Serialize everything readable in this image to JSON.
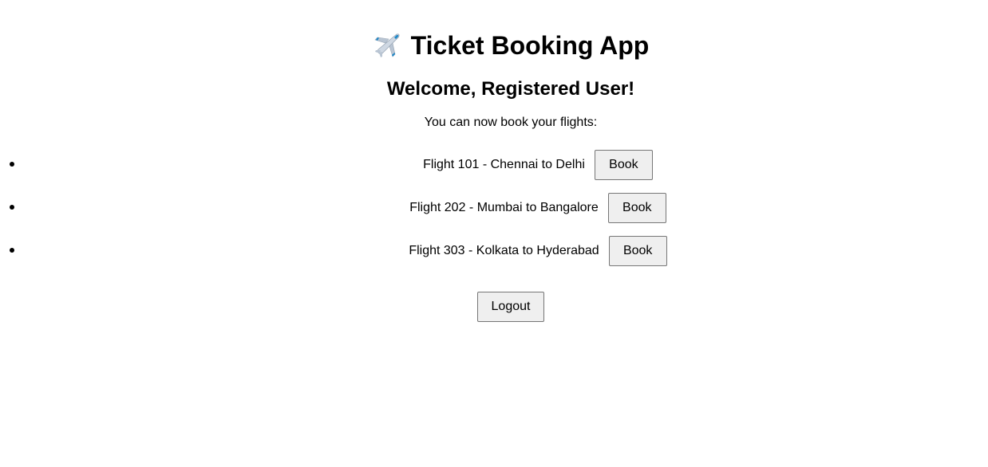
{
  "header": {
    "title": "Ticket Booking App",
    "icon": "airplane-icon"
  },
  "welcome": {
    "heading": "Welcome, Registered User!",
    "subtext": "You can now book your flights:"
  },
  "flights": [
    {
      "label": "Flight 101 - Chennai to Delhi",
      "button": "Book"
    },
    {
      "label": "Flight 202 - Mumbai to Bangalore",
      "button": "Book"
    },
    {
      "label": "Flight 303 - Kolkata to Hyderabad",
      "button": "Book"
    }
  ],
  "actions": {
    "logout_label": "Logout"
  },
  "colors": {
    "button_bg": "#efefef",
    "button_border": "#767676",
    "plane_body": "#cfd8e3",
    "plane_accent": "#1e88c8"
  }
}
